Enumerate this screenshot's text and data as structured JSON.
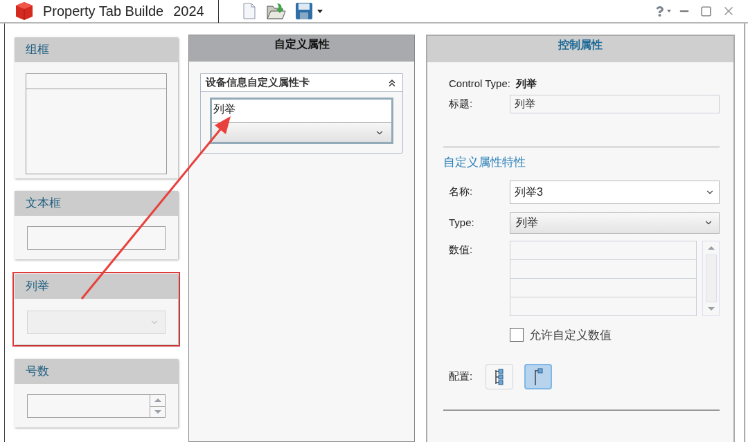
{
  "title_bar": {
    "app_name": "Property Tab Builde",
    "version": "2024"
  },
  "palette": [
    {
      "kind": "groupbox",
      "label": "组框",
      "selected": false
    },
    {
      "kind": "textbox",
      "label": "文本框",
      "selected": false
    },
    {
      "kind": "list",
      "label": "列举",
      "selected": true
    },
    {
      "kind": "number",
      "label": "号数",
      "selected": false
    }
  ],
  "custom_properties": {
    "header": "自定义属性",
    "card_title": "设备信息自定义属性卡",
    "control_label": "列举"
  },
  "control_properties": {
    "header": "控制属性",
    "control_type_label": "Control Type:",
    "control_type": "列举",
    "caption_label": "标题:",
    "caption_value": "列举",
    "section_title": "自定义属性特性",
    "name_label": "名称:",
    "name_value": "列举3",
    "type_label": "Type:",
    "type_value": "列举",
    "values_label": "数值:",
    "allow_custom": {
      "label": "允许自定义数值",
      "checked": false
    },
    "config_label": "配置:",
    "config_buttons": [
      {
        "kind": "tree",
        "selected": false
      },
      {
        "kind": "flag",
        "selected": true
      }
    ]
  }
}
